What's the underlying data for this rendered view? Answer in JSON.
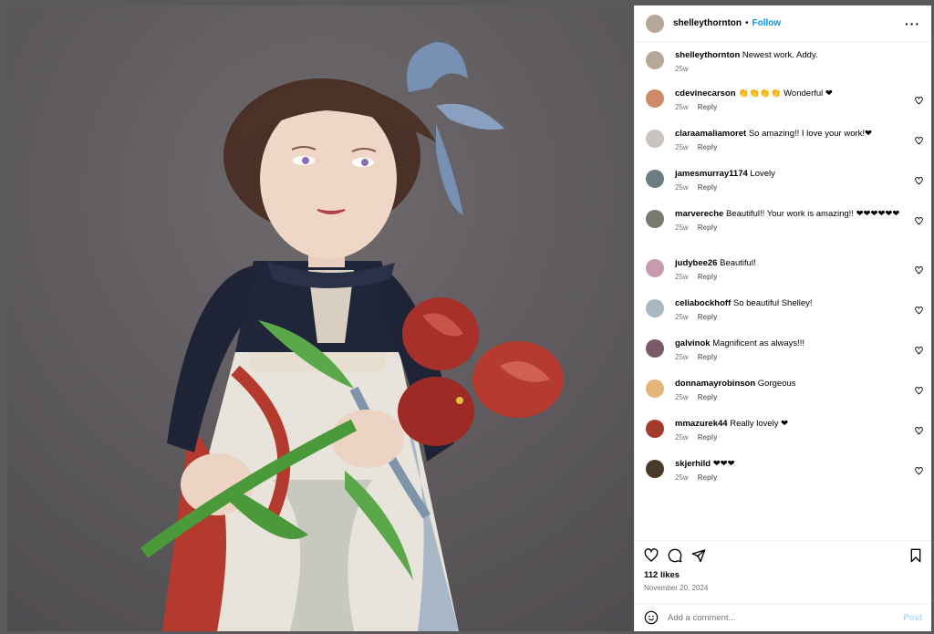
{
  "post": {
    "username": "shelleythornton",
    "follow_label": "Follow",
    "dot": "•",
    "more": "···"
  },
  "comments": [
    {
      "user": "shelleythornton",
      "text": "Newest work. Addy.",
      "time": "25w",
      "reply": "",
      "avatar_color": "#b8a89a",
      "like": false
    },
    {
      "user": "cdevinecarson",
      "text": "👏👏👏👏 Wonderful ❤",
      "time": "25w",
      "reply": "Reply",
      "avatar_color": "#d08a6a",
      "like": true
    },
    {
      "user": "claraamaliamoret",
      "text": "So amazing!! I love your work!❤",
      "time": "25w",
      "reply": "Reply",
      "avatar_color": "#c9c3c0",
      "like": true
    },
    {
      "user": "jamesmurray1174",
      "text": "Lovely",
      "time": "25w",
      "reply": "Reply",
      "avatar_color": "#6b7d80",
      "like": true
    },
    {
      "user": "marvereche",
      "text": "Beautiful!! Your work is amazing!! ❤❤❤❤❤❤",
      "time": "25w",
      "reply": "Reply",
      "avatar_color": "#7b7a72",
      "like": true
    },
    {
      "user": "judybee26",
      "text": "Beautiful!",
      "time": "25w",
      "reply": "Reply",
      "avatar_color": "#c79bb0",
      "like": true
    },
    {
      "user": "celiabockhoff",
      "text": "So beautiful Shelley!",
      "time": "25w",
      "reply": "Reply",
      "avatar_color": "#a8b8c0",
      "like": true
    },
    {
      "user": "galvinok",
      "text": "Magnificent as always!!!",
      "time": "25w",
      "reply": "Reply",
      "avatar_color": "#7a5a68",
      "like": true
    },
    {
      "user": "donnamayrobinson",
      "text": "Gorgeous",
      "time": "25w",
      "reply": "Reply",
      "avatar_color": "#e3b57a",
      "like": true
    },
    {
      "user": "mmazurek44",
      "text": "Really lovely ❤",
      "time": "25w",
      "reply": "Reply",
      "avatar_color": "#a33a2a",
      "like": true
    },
    {
      "user": "skjerhild",
      "text": "❤❤❤",
      "time": "25w",
      "reply": "Reply",
      "avatar_color": "#4a3a2a",
      "like": true
    }
  ],
  "actions": {
    "likes": "112 likes",
    "date": "November 20, 2024",
    "comment_placeholder": "Add a comment...",
    "post_label": "Post"
  },
  "icons": [
    "heart-icon",
    "comment-icon",
    "share-icon",
    "bookmark-icon",
    "emoji-icon",
    "more-options-icon"
  ],
  "colors": {
    "accent": "#0095f6",
    "heart": "#e0245e"
  }
}
